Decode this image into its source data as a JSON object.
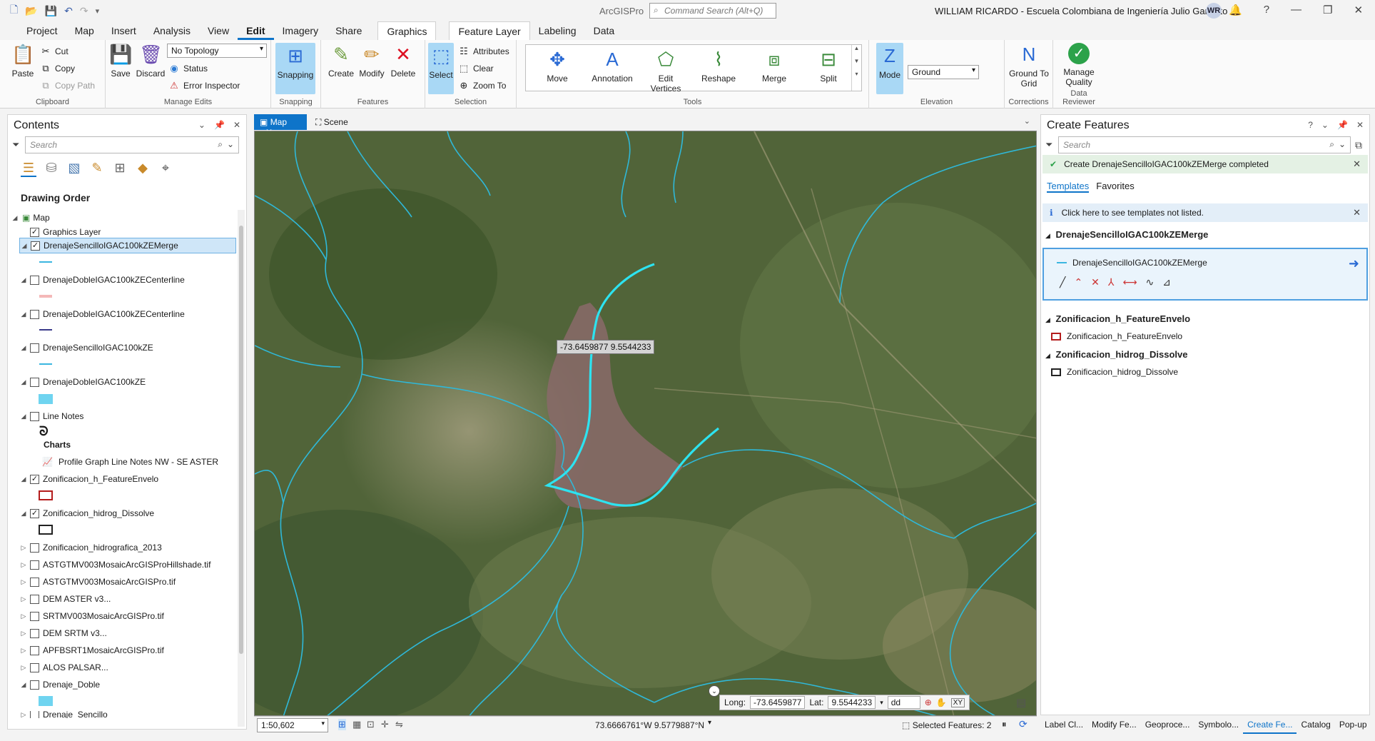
{
  "window": {
    "app_name": "ArcGISPro",
    "command_search_placeholder": "Command Search (Alt+Q)",
    "user": "WILLIAM RICARDO  - Escuela Colombiana de Ingeniería Julio Garavito",
    "avatar_initials": "WR"
  },
  "ribbon_tabs": [
    "Project",
    "Map",
    "Insert",
    "Analysis",
    "View",
    "Edit",
    "Imagery",
    "Share",
    "Graphics",
    "Feature Layer",
    "Labeling",
    "Data"
  ],
  "active_tab": "Edit",
  "ribbon": {
    "clipboard": {
      "label": "Clipboard",
      "paste": "Paste",
      "cut": "Cut",
      "copy": "Copy",
      "copy_path": "Copy Path"
    },
    "manage_edits": {
      "label": "Manage Edits",
      "save": "Save",
      "discard": "Discard",
      "topology": "No Topology",
      "status": "Status",
      "error_inspector": "Error Inspector"
    },
    "snapping": {
      "label": "Snapping",
      "snapping": "Snapping"
    },
    "features": {
      "label": "Features",
      "create": "Create",
      "modify": "Modify",
      "delete": "Delete"
    },
    "selection": {
      "label": "Selection",
      "select": "Select",
      "attributes": "Attributes",
      "clear": "Clear",
      "zoom_to": "Zoom To"
    },
    "tools": {
      "label": "Tools",
      "items": [
        "Move",
        "Annotation",
        "Edit Vertices",
        "Reshape",
        "Merge",
        "Split"
      ]
    },
    "elevation": {
      "label": "Elevation",
      "mode": "Mode",
      "surface": "Ground"
    },
    "corrections": {
      "label": "Corrections",
      "ground_to_grid": "Ground To Grid"
    },
    "data_reviewer": {
      "label": "Data Reviewer",
      "manage_quality": "Manage Quality"
    }
  },
  "contents": {
    "title": "Contents",
    "search_placeholder": "Search",
    "section": "Drawing Order",
    "layers": [
      {
        "name": "Map",
        "checked": null,
        "expanded": true,
        "indent": 0
      },
      {
        "name": "Graphics Layer",
        "checked": true,
        "expanded": null,
        "indent": 1
      },
      {
        "name": "DrenajeSencilloIGAC100kZEMerge",
        "checked": true,
        "expanded": true,
        "indent": 1,
        "selected": true
      },
      {
        "name": "DrenajeDobleIGAC100kZECenterline",
        "checked": false,
        "expanded": true,
        "indent": 1
      },
      {
        "name": "DrenajeDobleIGAC100kZECenterline",
        "checked": false,
        "expanded": true,
        "indent": 1
      },
      {
        "name": "DrenajeSencilloIGAC100kZE",
        "checked": false,
        "expanded": true,
        "indent": 1
      },
      {
        "name": "DrenajeDobleIGAC100kZE",
        "checked": false,
        "expanded": true,
        "indent": 1
      },
      {
        "name": "Line Notes",
        "checked": false,
        "expanded": true,
        "indent": 1
      },
      {
        "name": "Zonificacion_h_FeatureEnvelo",
        "checked": true,
        "expanded": true,
        "indent": 1
      },
      {
        "name": "Zonificacion_hidrog_Dissolve",
        "checked": true,
        "expanded": true,
        "indent": 1
      },
      {
        "name": "Zonificacion_hidrografica_2013",
        "checked": false,
        "expanded": false,
        "indent": 1
      },
      {
        "name": "ASTGTMV003MosaicArcGISProHillshade.tif",
        "checked": false,
        "expanded": false,
        "indent": 1
      },
      {
        "name": "ASTGTMV003MosaicArcGISPro.tif",
        "checked": false,
        "expanded": false,
        "indent": 1
      },
      {
        "name": "DEM ASTER v3...",
        "checked": false,
        "expanded": false,
        "indent": 1
      },
      {
        "name": "SRTMV003MosaicArcGISPro.tif",
        "checked": false,
        "expanded": false,
        "indent": 1
      },
      {
        "name": "DEM SRTM v3...",
        "checked": false,
        "expanded": false,
        "indent": 1
      },
      {
        "name": "APFBSRT1MosaicArcGISPro.tif",
        "checked": false,
        "expanded": false,
        "indent": 1
      },
      {
        "name": "ALOS PALSAR...",
        "checked": false,
        "expanded": false,
        "indent": 1
      },
      {
        "name": "Drenaje_Doble",
        "checked": false,
        "expanded": true,
        "indent": 1
      },
      {
        "name": "Drenaje_Sencillo",
        "checked": false,
        "expanded": false,
        "indent": 1
      }
    ],
    "charts_label": "Charts",
    "chart_item": "Profile Graph Line Notes NW - SE ASTER"
  },
  "map_tabs": [
    "Map",
    "Scene"
  ],
  "map": {
    "tooltip": "-73.6459877  9.5544233",
    "long_label": "Long:",
    "long_value": "-73.6459877",
    "lat_label": "Lat:",
    "lat_value": "9.5544233",
    "format": "dd",
    "scale": "1:50,602",
    "cursor_coords": "73.6666761°W 9.5779887°N",
    "selected_features": "Selected Features: 2"
  },
  "create_features": {
    "title": "Create Features",
    "search_placeholder": "Search",
    "success_msg": "Create DrenajeSencilloIGAC100kZEMerge completed",
    "tabs": [
      "Templates",
      "Favorites"
    ],
    "info_msg": "Click here to see templates not listed.",
    "groups": [
      {
        "header": "DrenajeSencilloIGAC100kZEMerge",
        "template": "DrenajeSencilloIGAC100kZEMerge"
      },
      {
        "header": "Zonificacion_h_FeatureEnvelo",
        "template": "Zonificacion_h_FeatureEnvelo"
      },
      {
        "header": "Zonificacion_hidrog_Dissolve",
        "template": "Zonificacion_hidrog_Dissolve"
      }
    ]
  },
  "bottom_tabs": [
    "Label Cl...",
    "Modify Fe...",
    "Geoproce...",
    "Symbolo...",
    "Create Fe...",
    "Catalog",
    "Pop-up"
  ],
  "active_bottom_tab": "Create Fe...",
  "colors": {
    "accent": "#0e74c9",
    "river": "#2fb8d8",
    "selected_line": "#2de3f0",
    "lake": "#8a6a6a"
  }
}
